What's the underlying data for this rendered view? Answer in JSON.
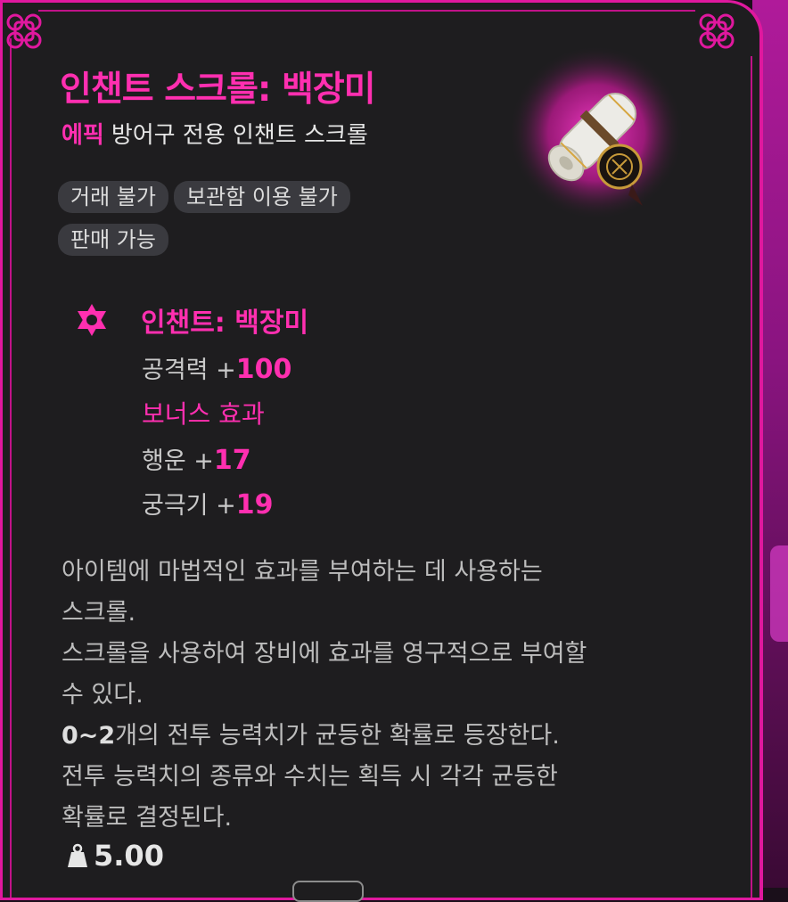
{
  "item": {
    "title": "인챈트 스크롤: 백장미",
    "grade": "에픽",
    "type": "방어구 전용 인챈트 스크롤",
    "tags": [
      "거래 불가",
      "보관함 이용 불가",
      "판매 가능"
    ]
  },
  "enchant": {
    "name": "인챈트: 백장미",
    "attack_label": "공격력 +",
    "attack_value": "100",
    "bonus_label": "보너스 효과",
    "luck_label": "행운 +",
    "luck_value": "17",
    "ultimate_label": "궁극기 +",
    "ultimate_value": "19"
  },
  "description": {
    "line1": "아이템에 마법적인 효과를 부여하는 데 사용하는",
    "line2": "스크롤.",
    "line3": "스크롤을 사용하여 장비에 효과를 영구적으로 부여할",
    "line4": "수 있다.",
    "line5_bold": "0~2",
    "line5_rest": "개의 전투 능력치가 균등한 확률로 등장한다.",
    "line6": "전투 능력치의 종류와 수치는 획득 시 각각 균등한",
    "line7": "확률로 결정된다."
  },
  "weight": "5.00",
  "colors": {
    "accent": "#ff2fb0",
    "border": "#e0189e",
    "panel": "#1e1d1f",
    "tag_bg": "#3a3a3f"
  },
  "icons": {
    "item": "scroll-icon",
    "enchant": "hexagram-icon",
    "weight": "weight-icon",
    "corner": "celtic-knot-icon"
  }
}
